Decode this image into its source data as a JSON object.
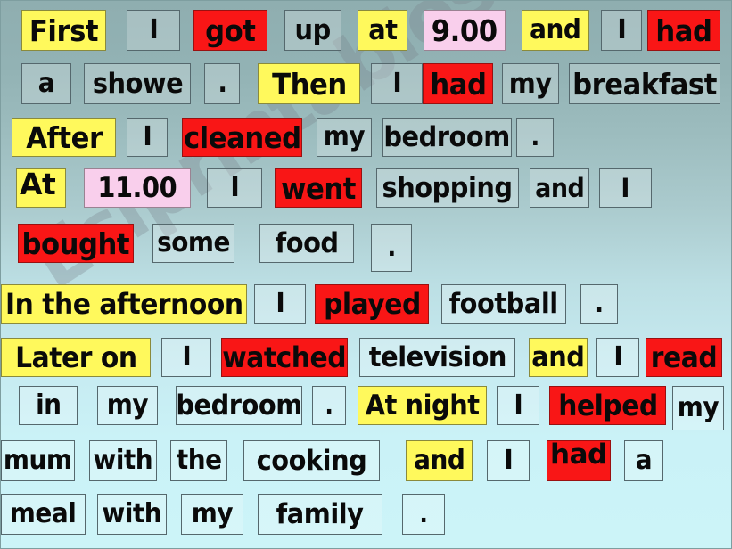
{
  "page": {
    "title": "Sentence building cards - daily routine past simple",
    "watermark": "Eslprintables.com",
    "background_top_color": "#8FAEB0",
    "background_bottom_color": "#CCF4F8"
  },
  "palette": {
    "yellow": "#FFF95C",
    "red": "#F91616",
    "pink": "#F9CFEC",
    "transparent": "rgba(255,255,255,0.22)",
    "text": "#0A0A0A"
  },
  "rows": [
    {
      "id": "row-1",
      "cards": [
        {
          "text": "First",
          "color": "yellow"
        },
        {
          "text": "I",
          "color": "clear"
        },
        {
          "text": "got",
          "color": "red"
        },
        {
          "text": "up",
          "color": "clear"
        },
        {
          "text": "at",
          "color": "yellow"
        },
        {
          "text": "9.00",
          "color": "pink"
        },
        {
          "text": "and",
          "color": "yellow"
        },
        {
          "text": "I",
          "color": "clear"
        },
        {
          "text": "had",
          "color": "red"
        }
      ]
    },
    {
      "id": "row-2",
      "cards": [
        {
          "text": "a",
          "color": "clear"
        },
        {
          "text": "showe",
          "color": "clear"
        },
        {
          "text": ".",
          "color": "clear"
        },
        {
          "text": "Then",
          "color": "yellow"
        },
        {
          "text": "I",
          "color": "clear"
        },
        {
          "text": "had",
          "color": "red"
        },
        {
          "text": "my",
          "color": "clear"
        },
        {
          "text": "breakfast",
          "color": "clear"
        }
      ]
    },
    {
      "id": "row-3",
      "cards": [
        {
          "text": "After",
          "color": "yellow"
        },
        {
          "text": "I",
          "color": "clear"
        },
        {
          "text": "cleaned",
          "color": "red"
        },
        {
          "text": "my",
          "color": "clear"
        },
        {
          "text": "bedroom",
          "color": "clear"
        },
        {
          "text": ".",
          "color": "clear"
        }
      ]
    },
    {
      "id": "row-4",
      "cards": [
        {
          "text": "At",
          "color": "yellow",
          "overflow": true
        },
        {
          "text": "11.00",
          "color": "pink"
        },
        {
          "text": "I",
          "color": "clear"
        },
        {
          "text": "went",
          "color": "red"
        },
        {
          "text": "shopping",
          "color": "clear"
        },
        {
          "text": "and",
          "color": "clear"
        },
        {
          "text": "I",
          "color": "clear"
        }
      ]
    },
    {
      "id": "row-5",
      "cards": [
        {
          "text": "bought",
          "color": "red"
        },
        {
          "text": "some",
          "color": "clear"
        },
        {
          "text": "food",
          "color": "clear"
        },
        {
          "text": ".",
          "color": "clear"
        }
      ]
    },
    {
      "id": "row-6",
      "cards": [
        {
          "text": "In the afternoon",
          "color": "yellow"
        },
        {
          "text": "I",
          "color": "clear"
        },
        {
          "text": "played",
          "color": "red"
        },
        {
          "text": "football",
          "color": "clear"
        },
        {
          "text": ".",
          "color": "clear"
        }
      ]
    },
    {
      "id": "row-7",
      "cards": [
        {
          "text": "Later on",
          "color": "yellow"
        },
        {
          "text": "I",
          "color": "clear"
        },
        {
          "text": "watched",
          "color": "red"
        },
        {
          "text": "television",
          "color": "clear"
        },
        {
          "text": "and",
          "color": "yellow"
        },
        {
          "text": "I",
          "color": "clear"
        },
        {
          "text": "read",
          "color": "red"
        }
      ]
    },
    {
      "id": "row-8",
      "cards": [
        {
          "text": "in",
          "color": "clear"
        },
        {
          "text": "my",
          "color": "clear"
        },
        {
          "text": "bedroom",
          "color": "clear"
        },
        {
          "text": ".",
          "color": "clear"
        },
        {
          "text": "At night",
          "color": "yellow"
        },
        {
          "text": "I",
          "color": "clear"
        },
        {
          "text": "helped",
          "color": "red"
        },
        {
          "text": "my",
          "color": "clear"
        }
      ]
    },
    {
      "id": "row-9",
      "cards": [
        {
          "text": "mum",
          "color": "clear"
        },
        {
          "text": "with",
          "color": "clear"
        },
        {
          "text": "the",
          "color": "clear"
        },
        {
          "text": "cooking",
          "color": "clear"
        },
        {
          "text": "and",
          "color": "yellow"
        },
        {
          "text": "I",
          "color": "clear"
        },
        {
          "text": "had",
          "color": "red",
          "overflow": true
        },
        {
          "text": "a",
          "color": "clear"
        }
      ]
    },
    {
      "id": "row-10",
      "cards": [
        {
          "text": "meal",
          "color": "clear"
        },
        {
          "text": "with",
          "color": "clear"
        },
        {
          "text": "my",
          "color": "clear"
        },
        {
          "text": "family",
          "color": "clear"
        },
        {
          "text": ".",
          "color": "clear"
        }
      ]
    }
  ],
  "sentence_text": "First I got up at 9.00 and I had a showe . Then I had my breakfast After I cleaned my bedroom . At 11.00 I went shopping and I bought some food . In the afternoon I played football . Later on I watched television and I read in my bedroom . At night I helped my mum with the cooking and I had a meal with my family ."
}
